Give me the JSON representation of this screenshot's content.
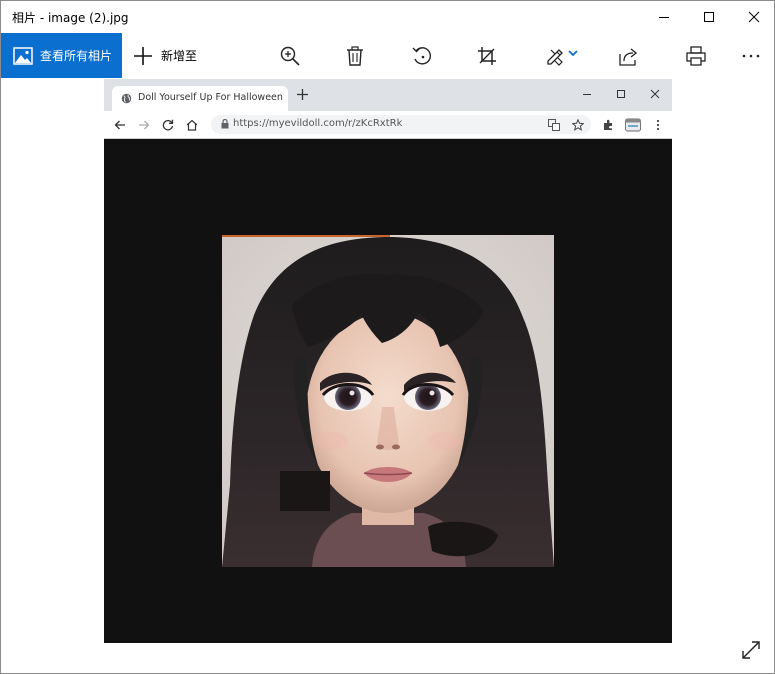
{
  "app": {
    "title": "相片 - image (2).jpg"
  },
  "window_controls": {
    "minimize": "minimize-icon",
    "maximize": "maximize-icon",
    "close": "close-icon"
  },
  "toolbar": {
    "all_photos_label": "查看所有相片",
    "add_to_label": "新增至",
    "tools": [
      "zoom-icon",
      "delete-icon",
      "rotate-icon",
      "crop-icon",
      "edit-icon",
      "share-icon",
      "print-icon",
      "more-icon"
    ],
    "accent": "#0a6fcf"
  },
  "browser": {
    "tab_title": "Doll Yourself Up For Halloween",
    "url": "https://myevildoll.com/r/zKcRxtRk"
  }
}
